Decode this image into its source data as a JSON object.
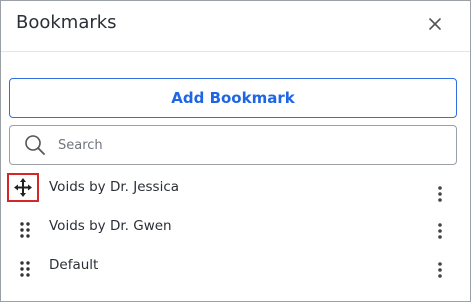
{
  "panel": {
    "title": "Bookmarks",
    "close_icon": "close-icon",
    "add_button_label": "Add Bookmark",
    "search": {
      "placeholder": "Search",
      "value": "",
      "icon": "search-icon"
    },
    "bookmarks": [
      {
        "label": "Voids by Dr. Jessica",
        "drag_icon": "move-arrows-icon",
        "highlighted": true,
        "menu_icon": "kebab-menu-icon"
      },
      {
        "label": "Voids by Dr. Gwen",
        "drag_icon": "drag-handle-icon",
        "highlighted": false,
        "menu_icon": "kebab-menu-icon"
      },
      {
        "label": "Default",
        "drag_icon": "drag-handle-icon",
        "highlighted": false,
        "menu_icon": "kebab-menu-icon"
      }
    ]
  },
  "colors": {
    "accent": "#1f66e5",
    "highlight_border": "#d62728",
    "text": "#2b2f36",
    "border": "#9aa0a6"
  }
}
